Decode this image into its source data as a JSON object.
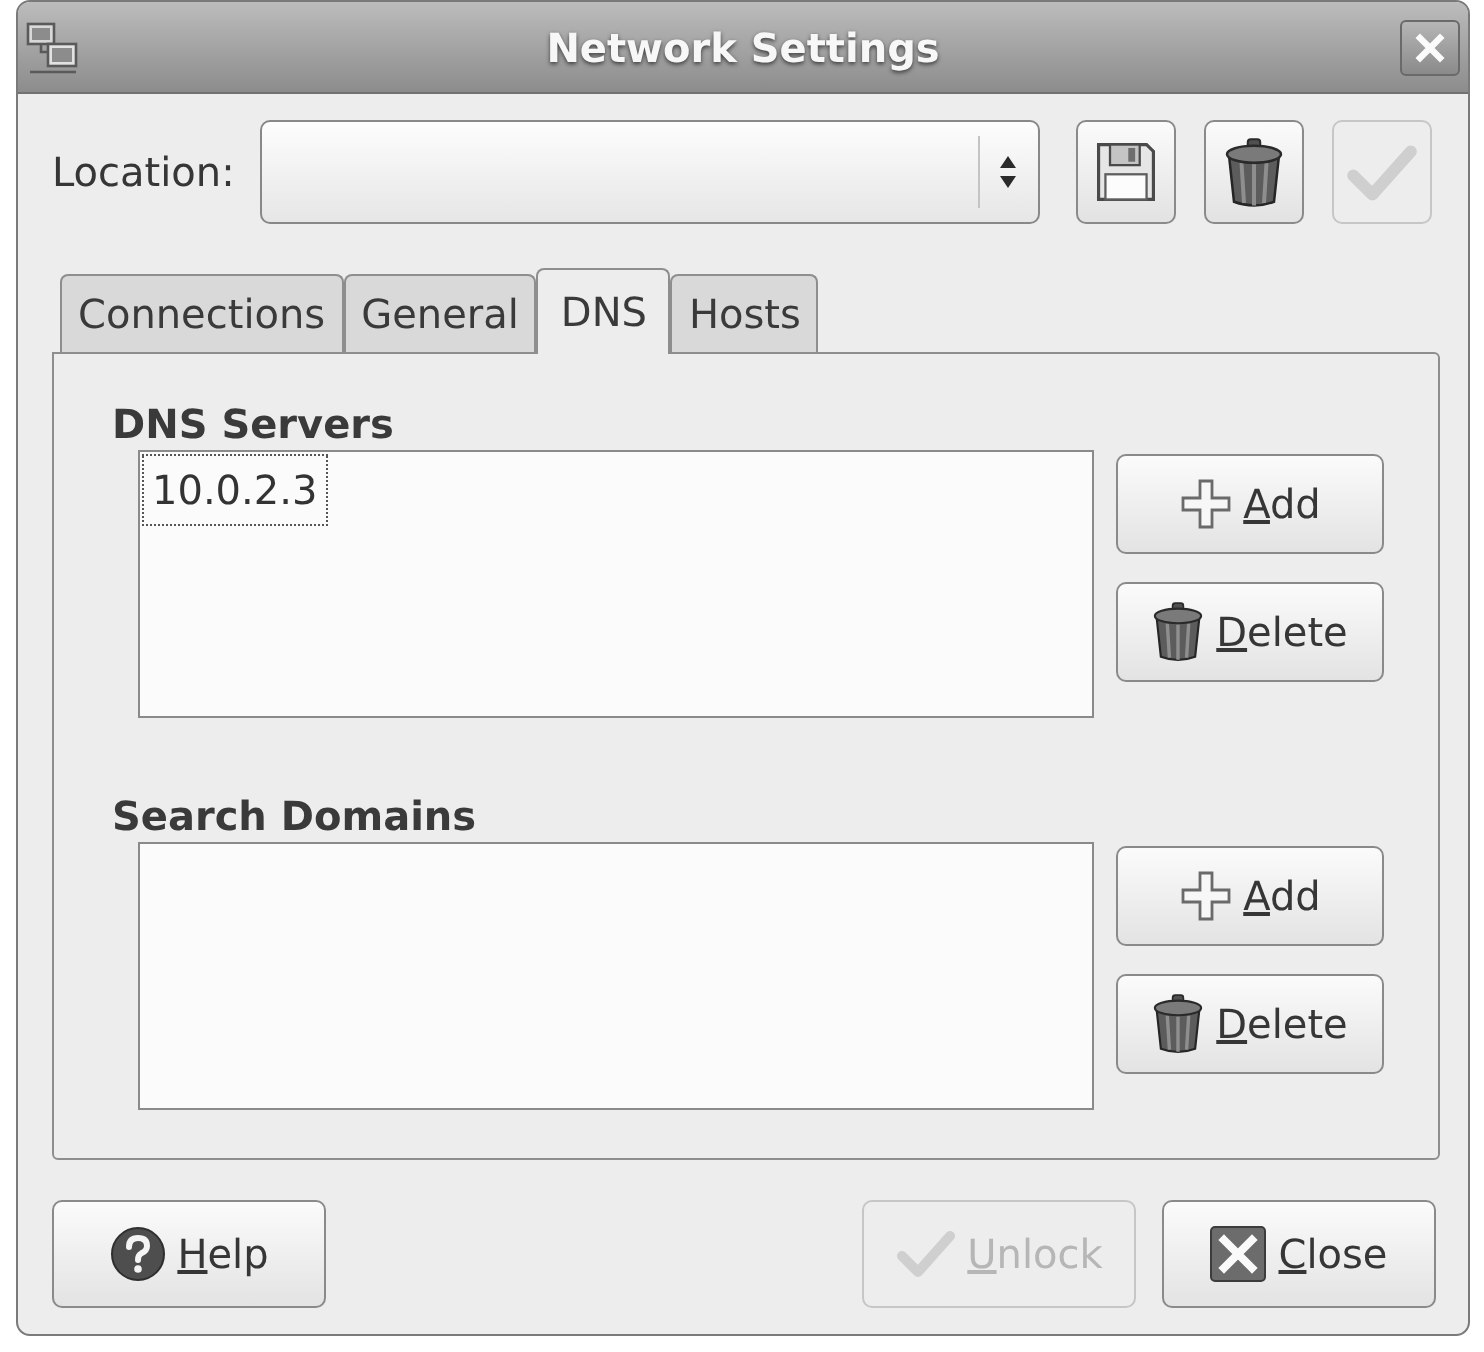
{
  "window": {
    "title": "Network Settings"
  },
  "location": {
    "label": "Location:"
  },
  "location_buttons": [
    {
      "kind": "save",
      "disabled": false
    },
    {
      "kind": "delete",
      "disabled": false
    },
    {
      "kind": "apply",
      "disabled": true
    }
  ],
  "tabs": [
    {
      "label": "Connections",
      "selected": false
    },
    {
      "label": "General",
      "selected": false
    },
    {
      "label": "DNS",
      "selected": true
    },
    {
      "label": "Hosts",
      "selected": false
    }
  ],
  "sections": [
    {
      "heading": "DNS Servers",
      "items": [
        {
          "text": "10.0.2.3",
          "focused": true
        }
      ],
      "buttons": [
        {
          "kind": "add",
          "label": "Add",
          "mnemonic": true
        },
        {
          "kind": "delete",
          "label": "Delete",
          "mnemonic": true
        }
      ]
    },
    {
      "heading": "Search Domains",
      "buttons": [
        {
          "kind": "add",
          "label": "Add",
          "mnemonic": true
        },
        {
          "kind": "delete",
          "label": "Delete",
          "mnemonic": true
        }
      ]
    }
  ],
  "footer_buttons": [
    {
      "kind": "help",
      "label": "Help",
      "mnemonic": true,
      "disabled": false
    },
    {
      "kind": "unlock",
      "label": "Unlock",
      "mnemonic": true,
      "disabled": true
    },
    {
      "kind": "close",
      "label": "Close",
      "mnemonic": true,
      "disabled": false
    }
  ]
}
